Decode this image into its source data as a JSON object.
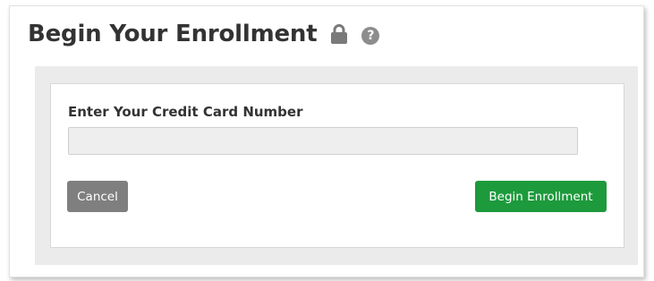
{
  "header": {
    "title": "Begin Your Enrollment",
    "lock_icon": "lock-icon",
    "help_icon": "question-circle-icon",
    "help_glyph": "?"
  },
  "form": {
    "card_label": "Enter Your Credit Card Number",
    "card_value": "",
    "card_placeholder": "",
    "cancel_label": "Cancel",
    "submit_label": "Begin Enrollment"
  },
  "colors": {
    "submit": "#1d9a3c",
    "cancel": "#7f7f7f",
    "panel": "#ebebeb",
    "help_icon": "#8d8d8d"
  }
}
